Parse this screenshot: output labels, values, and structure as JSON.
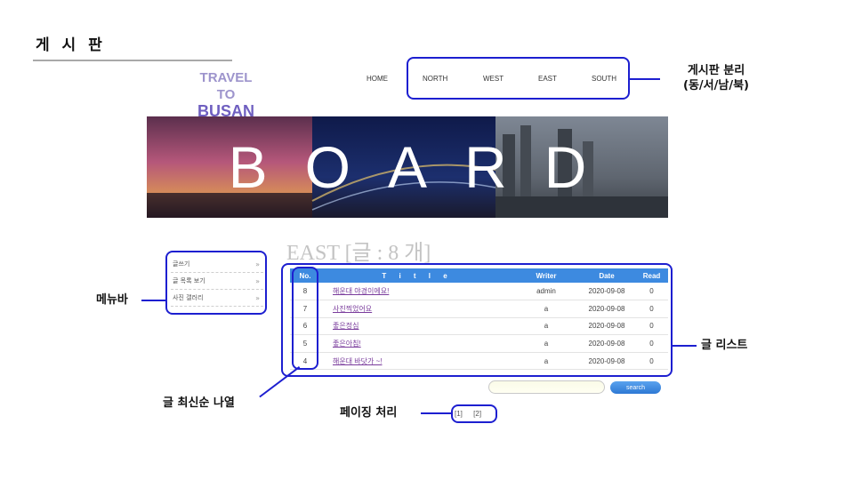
{
  "slide": {
    "title": "게 시 판"
  },
  "site": {
    "logo_line1": "TRAVEL TO",
    "logo_line2": "BUSAN",
    "nav": [
      "HOME",
      "NORTH",
      "WEST",
      "EAST",
      "SOUTH"
    ]
  },
  "banner": {
    "text": "BOARD"
  },
  "board": {
    "title": "EAST [글 : 8 개]",
    "columns": [
      "No.",
      "T i t l e",
      "Writer",
      "Date",
      "Read"
    ],
    "rows": [
      {
        "no": "8",
        "title": "해운대 야경이에요!",
        "writer": "admin",
        "date": "2020-09-08",
        "read": "0"
      },
      {
        "no": "7",
        "title": "사진찍었어요",
        "writer": "a",
        "date": "2020-09-08",
        "read": "0"
      },
      {
        "no": "6",
        "title": "좋은정심",
        "writer": "a",
        "date": "2020-09-08",
        "read": "0"
      },
      {
        "no": "5",
        "title": "좋은아침!",
        "writer": "a",
        "date": "2020-09-08",
        "read": "0"
      },
      {
        "no": "4",
        "title": "해운대 바닷가 ~!",
        "writer": "a",
        "date": "2020-09-08",
        "read": "0"
      }
    ],
    "search_value": "",
    "search_button": "search",
    "pages": [
      "[1]",
      "[2]"
    ]
  },
  "side_menu": {
    "items": [
      {
        "label": "글쓰기",
        "arrow": "»"
      },
      {
        "label": "글 목록 보기",
        "arrow": "»"
      },
      {
        "label": "사진 갤러리",
        "arrow": "»"
      }
    ]
  },
  "annotations": {
    "board_split_line1": "게시판 분리",
    "board_split_line2": "(동/서/남/북)",
    "menubar": "메뉴바",
    "post_list": "글 리스트",
    "latest_order": "글 최신순 나열",
    "paging": "페이징 처리"
  },
  "colors": {
    "accent": "#1d1fd0",
    "table_header": "#3d8ae0",
    "logo": "#6f5fc0"
  }
}
